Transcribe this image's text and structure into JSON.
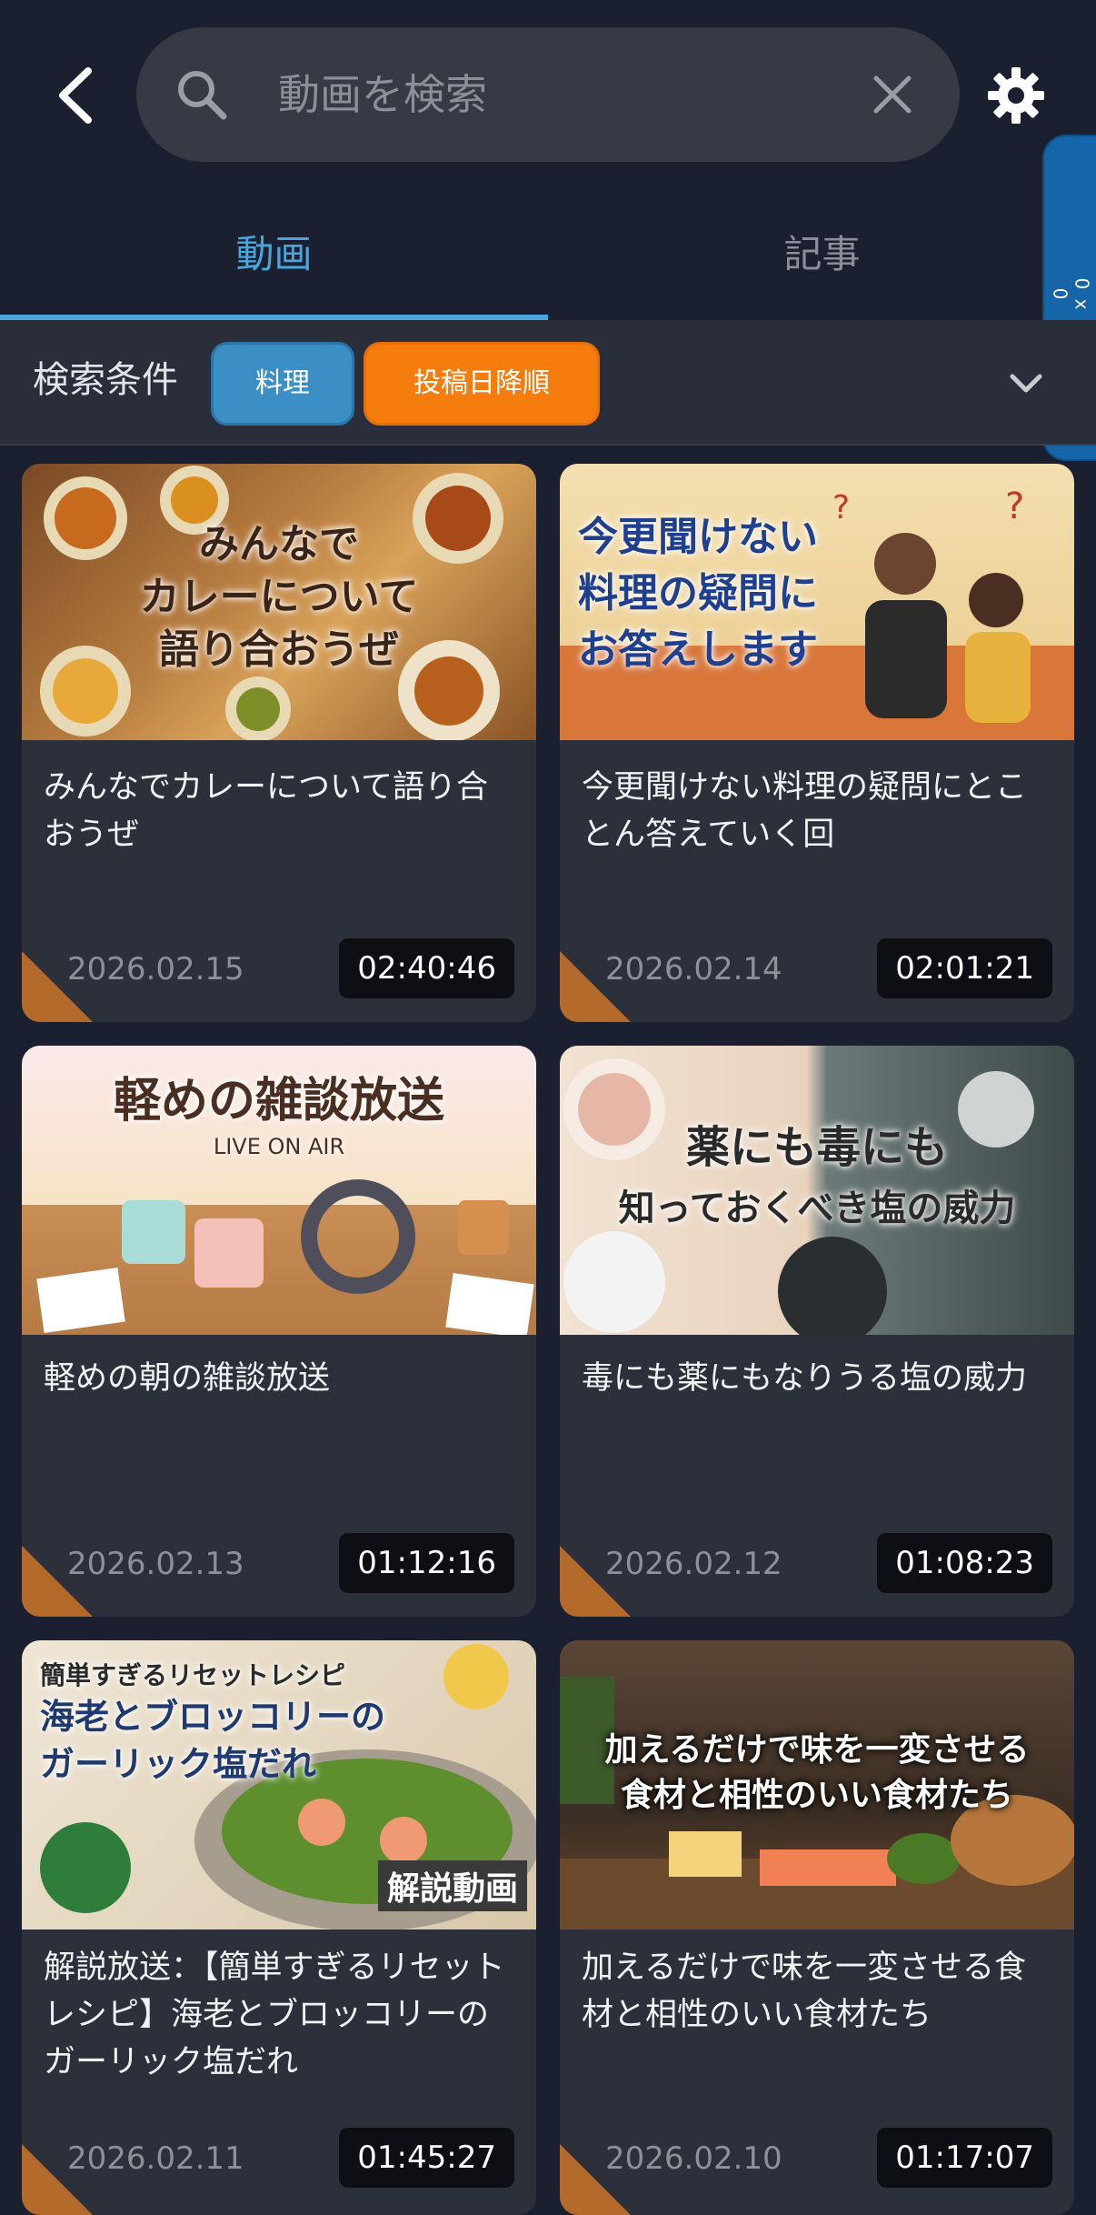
{
  "header": {
    "search_placeholder": "動画を検索",
    "side_tab_label": "0 x 0"
  },
  "tabs": [
    {
      "label": "動画",
      "active": true
    },
    {
      "label": "記事",
      "active": false
    }
  ],
  "filter": {
    "label": "検索条件",
    "chips": [
      "料理",
      "投稿日降順"
    ]
  },
  "videos": [
    {
      "thumb_caption": "みんなで\nカレーについて\n語り合おうぜ",
      "title": "みんなでカレーについて語り合おうぜ",
      "date": "2026.02.15",
      "duration": "02:40:46"
    },
    {
      "thumb_caption": "今更聞けない\n料理の疑問に\nお答えします",
      "title": "今更聞けない料理の疑問にとことん答えていく回",
      "date": "2026.02.14",
      "duration": "02:01:21"
    },
    {
      "thumb_caption": "軽めの雑談放送\nLIVE ON AIR",
      "title": "軽めの朝の雑談放送",
      "date": "2026.02.13",
      "duration": "01:12:16"
    },
    {
      "thumb_caption": "薬にも毒にも\n知っておくべき塩の威力",
      "title": "毒にも薬にもなりうる塩の威力",
      "date": "2026.02.12",
      "duration": "01:08:23"
    },
    {
      "thumb_caption": "簡単すぎるリセットレシピ\n海老とブロッコリーの\nガーリック塩だれ\n解説動画",
      "title": "解説放送：【簡単すぎるリセットレシピ】海老とブロッコリーのガーリック塩だれ",
      "date": "2026.02.11",
      "duration": "01:45:27"
    },
    {
      "thumb_caption": "加えるだけで味を一変させる\n食材と相性のいい食材たち",
      "title": "加えるだけで味を一変させる食材と相性のいい食材たち",
      "date": "2026.02.10",
      "duration": "01:17:07"
    }
  ]
}
